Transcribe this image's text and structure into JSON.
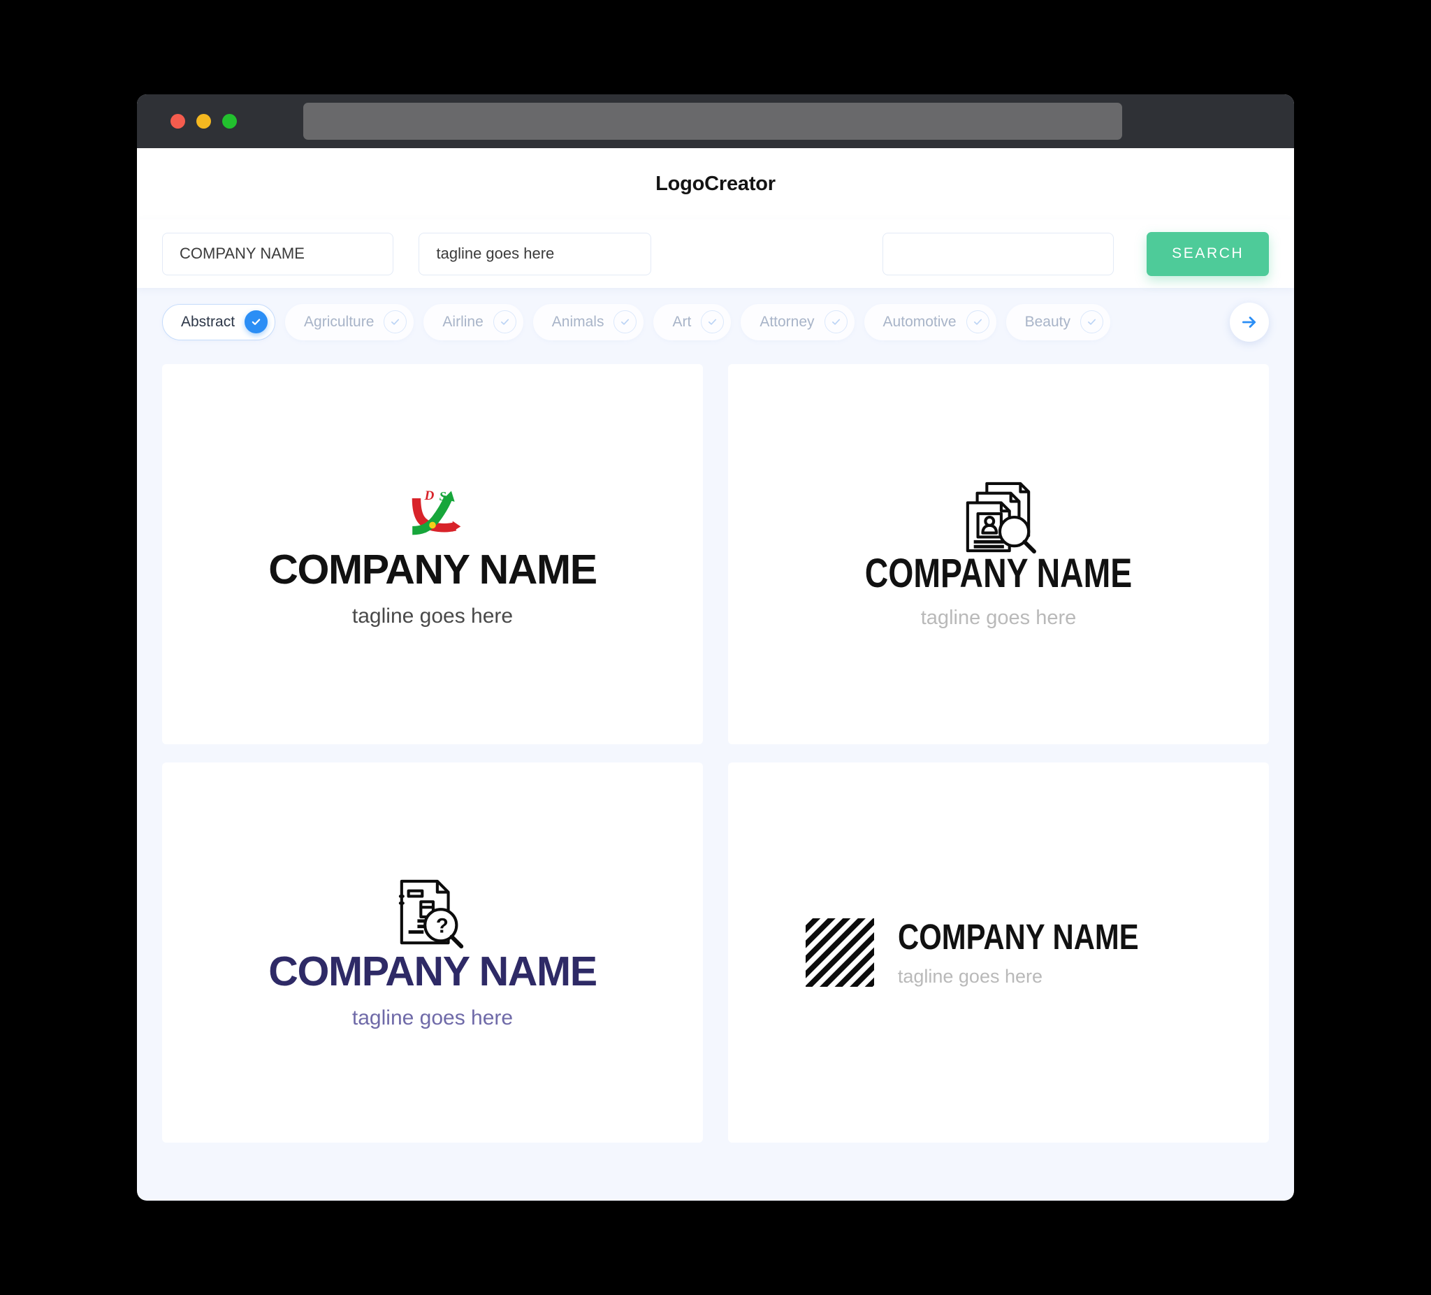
{
  "window": {
    "traffic_lights": [
      {
        "name": "close",
        "color": "#f55c4e"
      },
      {
        "name": "minimize",
        "color": "#f5b820"
      },
      {
        "name": "maximize",
        "color": "#22c02e"
      }
    ],
    "url_value": ""
  },
  "header": {
    "brand": "LogoCreator"
  },
  "search": {
    "company_value": "COMPANY NAME",
    "company_placeholder": "COMPANY NAME",
    "tagline_value": "tagline goes here",
    "tagline_placeholder": "tagline goes here",
    "extra_value": "",
    "extra_placeholder": "",
    "button_label": "SEARCH",
    "button_color": "#4ecb99"
  },
  "categories": {
    "accent_color": "#2b8ef5",
    "next_icon": "arrow-right-icon",
    "items": [
      {
        "label": "Abstract",
        "selected": true
      },
      {
        "label": "Agriculture",
        "selected": false
      },
      {
        "label": "Airline",
        "selected": false
      },
      {
        "label": "Animals",
        "selected": false
      },
      {
        "label": "Art",
        "selected": false
      },
      {
        "label": "Attorney",
        "selected": false
      },
      {
        "label": "Automotive",
        "selected": false
      },
      {
        "label": "Beauty",
        "selected": false
      }
    ]
  },
  "results": [
    {
      "icon": "crossed-arrows-ds-icon",
      "name": "COMPANY NAME",
      "tagline": "tagline goes here",
      "name_color": "#111111",
      "tagline_color": "#494949",
      "layout": "vertical"
    },
    {
      "icon": "resume-documents-search-icon",
      "name": "COMPANY NAME",
      "tagline": "tagline goes here",
      "name_color": "#111111",
      "tagline_color": "#b9b9b9",
      "layout": "vertical"
    },
    {
      "icon": "document-question-search-icon",
      "name": "COMPANY NAME",
      "tagline": "tagline goes here",
      "name_color": "#2e2a66",
      "tagline_color": "#6f6aa8",
      "layout": "vertical"
    },
    {
      "icon": "diagonal-stripes-square-icon",
      "name": "COMPANY NAME",
      "tagline": "tagline goes here",
      "name_color": "#111111",
      "tagline_color": "#b9b9b9",
      "layout": "horizontal"
    }
  ]
}
